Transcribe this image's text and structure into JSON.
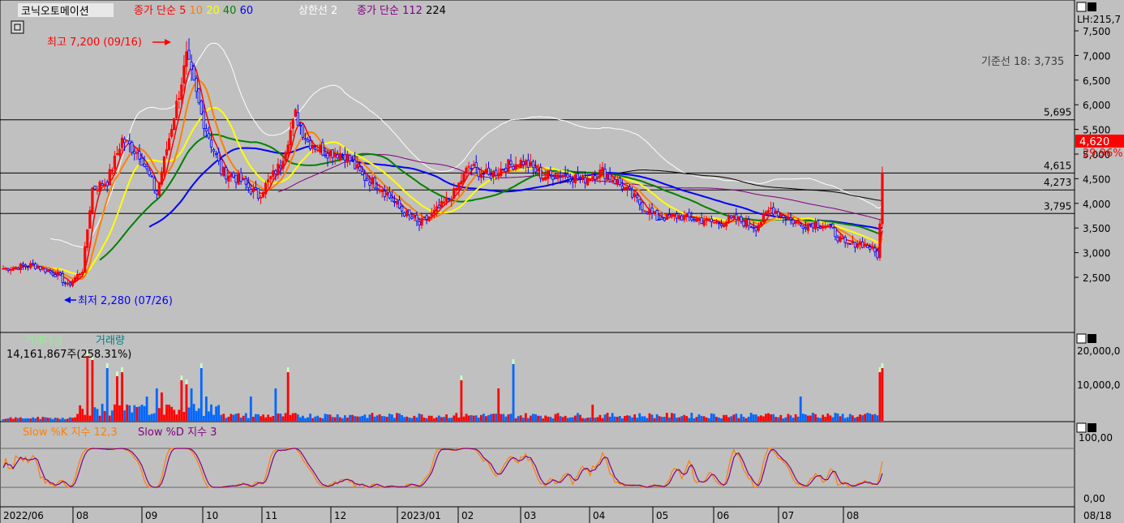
{
  "stock_name": "코닉오토메이션",
  "legend": {
    "ma_title": "종가 단순",
    "ma_periods": [
      {
        "label": "5",
        "color": "#ff0000"
      },
      {
        "label": "10",
        "color": "#ff7f00"
      },
      {
        "label": "20",
        "color": "#ffff00"
      },
      {
        "label": "40",
        "color": "#008000"
      },
      {
        "label": "60",
        "color": "#0000ff"
      }
    ],
    "envelope_label": "상한선 2",
    "ma2_title": "종가 단순",
    "ma2_periods": [
      {
        "label": "112",
        "color": "#800080"
      },
      {
        "label": "224",
        "color": "#000000"
      }
    ]
  },
  "top_right_label": "LH:215,7",
  "annotations": {
    "high": "최고 7,200 (09/16)",
    "low": "최저 2,280 (07/26)",
    "base_line": "기준선 18: 3,735"
  },
  "price_levels": [
    "5,695",
    "4,615",
    "4,273",
    "3,795"
  ],
  "current_price": "4,620",
  "change_pct": "29.96%",
  "price_axis_ticks": [
    "7,500",
    "7,000",
    "6,500",
    "6,000",
    "5,500",
    "5,000",
    "4,500",
    "4,000",
    "3,500",
    "3,000",
    "2,500"
  ],
  "volume_panel": {
    "label_amount": "거래대금",
    "label_volume": "거래량",
    "value": "14,161,867주(258.31%)",
    "axis_ticks": [
      "20,000,0",
      "10,000,0"
    ]
  },
  "stoch_panel": {
    "label_k": "Slow %K 지수 12,3",
    "label_d": "Slow %D 지수 3",
    "axis_ticks": [
      "100,00",
      "0,00"
    ]
  },
  "x_axis": {
    "labels": [
      "2022/06",
      "08",
      "09",
      "10",
      "11",
      "12",
      "2023/01",
      "02",
      "03",
      "04",
      "05",
      "06",
      "07",
      "08"
    ],
    "right_label": "08/18"
  },
  "colors": {
    "background": "#c0c0c0",
    "up": "#ff0000",
    "down": "#0000ff"
  },
  "chart_data": {
    "type": "candlestick",
    "x_axis_months": [
      "2022/06",
      "08",
      "09",
      "10",
      "11",
      "12",
      "2023/01",
      "02",
      "03",
      "04",
      "05",
      "06",
      "07",
      "08"
    ],
    "price_range": [
      2000,
      7800
    ],
    "high": 7200,
    "low": 2280,
    "last_close": 4620,
    "change_pct": 29.96,
    "price_anchor_points": [
      [
        0,
        2680
      ],
      [
        12,
        2750
      ],
      [
        22,
        2550
      ],
      [
        26,
        2330
      ],
      [
        32,
        2650
      ],
      [
        36,
        4300
      ],
      [
        42,
        4450
      ],
      [
        48,
        5300
      ],
      [
        55,
        5000
      ],
      [
        62,
        4200
      ],
      [
        70,
        6000
      ],
      [
        74,
        6950
      ],
      [
        80,
        5800
      ],
      [
        88,
        4650
      ],
      [
        95,
        4500
      ],
      [
        103,
        4150
      ],
      [
        112,
        4800
      ],
      [
        118,
        5800
      ],
      [
        123,
        5250
      ],
      [
        130,
        5050
      ],
      [
        138,
        5000
      ],
      [
        145,
        4550
      ],
      [
        152,
        4350
      ],
      [
        160,
        3900
      ],
      [
        168,
        3570
      ],
      [
        175,
        3850
      ],
      [
        182,
        4200
      ],
      [
        188,
        4750
      ],
      [
        196,
        4550
      ],
      [
        204,
        4780
      ],
      [
        210,
        4850
      ],
      [
        218,
        4550
      ],
      [
        226,
        4600
      ],
      [
        234,
        4480
      ],
      [
        242,
        4650
      ],
      [
        250,
        4350
      ],
      [
        258,
        3950
      ],
      [
        264,
        3700
      ],
      [
        272,
        3740
      ],
      [
        280,
        3680
      ],
      [
        288,
        3600
      ],
      [
        296,
        3680
      ],
      [
        304,
        3520
      ],
      [
        310,
        3900
      ],
      [
        316,
        3720
      ],
      [
        322,
        3560
      ],
      [
        328,
        3600
      ],
      [
        334,
        3500
      ],
      [
        340,
        3150
      ],
      [
        346,
        3200
      ],
      [
        350,
        3100
      ],
      [
        353,
        2950
      ],
      [
        354,
        3550
      ],
      [
        355,
        4620
      ]
    ]
  }
}
